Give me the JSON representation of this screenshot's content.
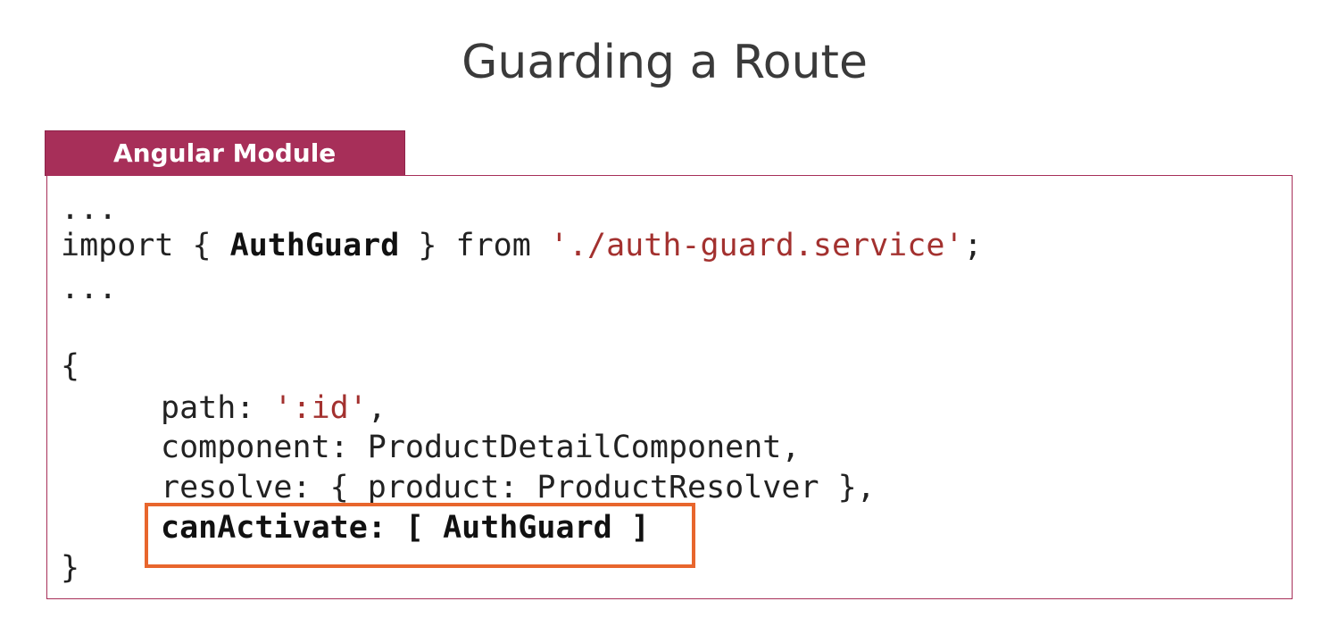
{
  "slide": {
    "title": "Guarding a Route",
    "module_tab_label": "Angular Module"
  },
  "code": {
    "line1": "...",
    "import_keyword": "import { ",
    "import_name": "AuthGuard",
    "import_from": " } from ",
    "import_path": "'./auth-guard.service'",
    "import_end": ";",
    "line3": "...",
    "open_brace": "{",
    "path_key": "path: ",
    "path_value": "':id'",
    "path_end": ",",
    "component_line": "component: ProductDetailComponent,",
    "resolve_line": "resolve: { product: ProductResolver },",
    "canactivate_line": "canActivate: [ AuthGuard ]",
    "close_brace": "}"
  },
  "colors": {
    "module_accent": "#a72f59",
    "string_color": "#a3312f",
    "highlight_border": "#e8662d"
  }
}
